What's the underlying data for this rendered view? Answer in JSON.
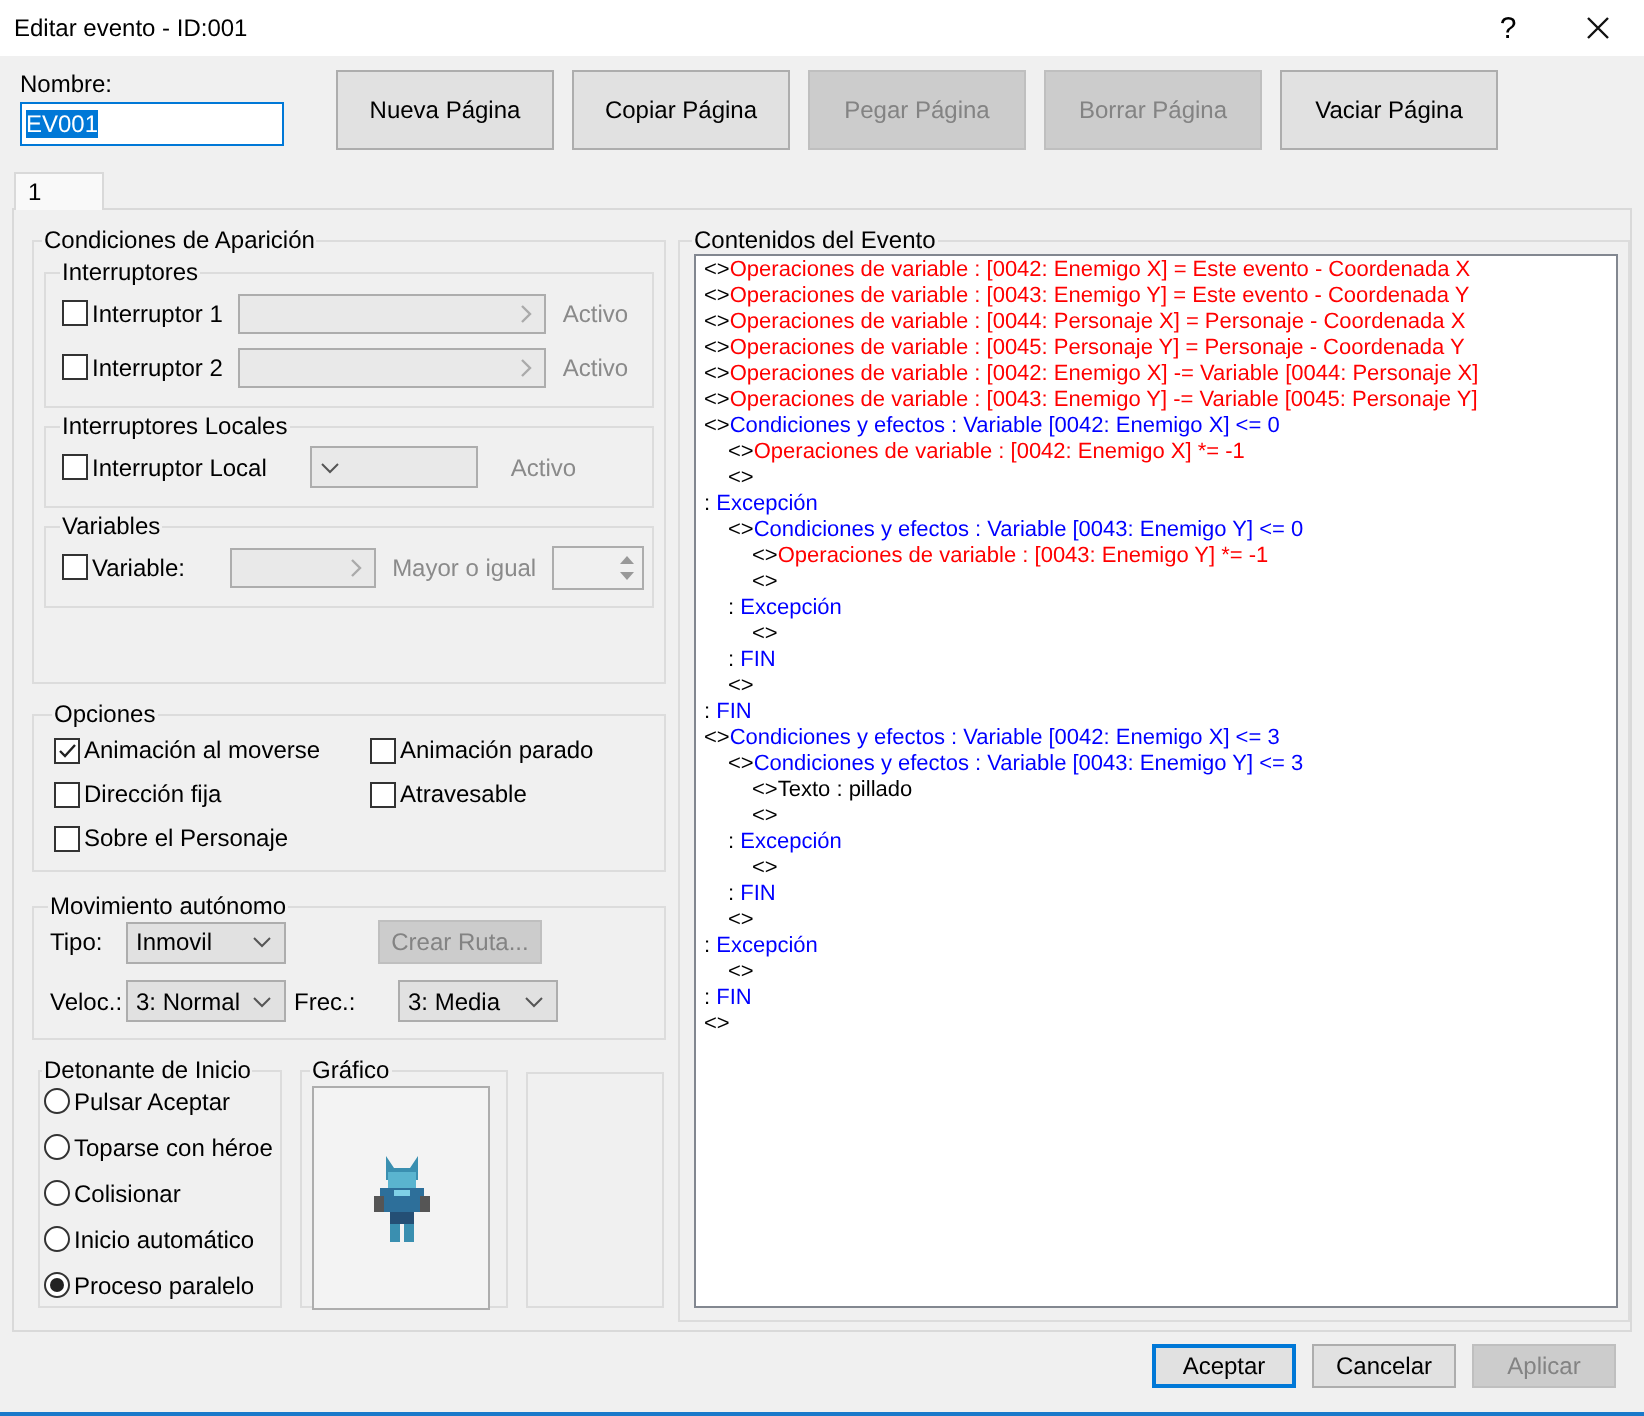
{
  "window": {
    "title": "Editar evento - ID:001",
    "help": "?"
  },
  "name_field": {
    "label": "Nombre:",
    "value": "EV001",
    "text_selected": true
  },
  "page_buttons": [
    {
      "label": "Nueva Página",
      "disabled": false
    },
    {
      "label": "Copiar Página",
      "disabled": false
    },
    {
      "label": "Pegar Página",
      "disabled": true
    },
    {
      "label": "Borrar Página",
      "disabled": true
    },
    {
      "label": "Vaciar Página",
      "disabled": false
    }
  ],
  "tabs": [
    {
      "label": "1",
      "selected": true
    }
  ],
  "conditions": {
    "title": "Condiciones de Aparición",
    "switches": {
      "title": "Interruptores",
      "items": [
        {
          "label": "Interruptor 1",
          "checked": false,
          "status": "Activo"
        },
        {
          "label": "Interruptor 2",
          "checked": false,
          "status": "Activo"
        }
      ]
    },
    "local_switches": {
      "title": "Interruptores Locales",
      "label": "Interruptor Local",
      "checked": false,
      "status": "Activo"
    },
    "variables": {
      "title": "Variables",
      "label": "Variable:",
      "checked": false,
      "comparison": "Mayor o igual"
    }
  },
  "options": {
    "title": "Opciones",
    "items": [
      {
        "label": "Animación al moverse",
        "checked": true
      },
      {
        "label": "Animación parado",
        "checked": false
      },
      {
        "label": "Dirección fija",
        "checked": false
      },
      {
        "label": "Atravesable",
        "checked": false
      },
      {
        "label": "Sobre el Personaje",
        "checked": false
      }
    ]
  },
  "movement": {
    "title": "Movimiento autónomo",
    "type_label": "Tipo:",
    "type": "Inmovil",
    "route_button": {
      "label": "Crear Ruta...",
      "disabled": true
    },
    "speed_label": "Veloc.:",
    "speed": "3: Normal",
    "frequency_label": "Frec.:",
    "frequency": "3: Media"
  },
  "trigger": {
    "title": "Detonante de Inicio",
    "options": [
      {
        "label": "Pulsar Aceptar",
        "selected": false
      },
      {
        "label": "Toparse con héroe",
        "selected": false
      },
      {
        "label": "Colisionar",
        "selected": false
      },
      {
        "label": "Inicio automático",
        "selected": false
      },
      {
        "label": "Proceso paralelo",
        "selected": true
      }
    ]
  },
  "graphic": {
    "title": "Gráfico",
    "kind": "picture"
  },
  "contents": {
    "title": "Contenidos del Evento",
    "lines": [
      {
        "prefix": "<>",
        "text": "Operaciones de variable : [0042: Enemigo X] = Este evento - Coordenada X",
        "kind": "command"
      },
      {
        "prefix": "<>",
        "text": "Operaciones de variable : [0043: Enemigo Y] = Este evento - Coordenada Y",
        "kind": "command"
      },
      {
        "prefix": "<>",
        "text": "Operaciones de variable : [0044: Personaje X] = Personaje - Coordenada X",
        "kind": "command"
      },
      {
        "prefix": "<>",
        "text": "Operaciones de variable : [0045: Personaje Y] = Personaje - Coordenada Y",
        "kind": "command"
      },
      {
        "prefix": "<>",
        "text": "Operaciones de variable : [0042: Enemigo X] -= Variable [0044: Personaje X]",
        "kind": "command"
      },
      {
        "prefix": "<>",
        "text": "Operaciones de variable : [0043: Enemigo Y] -= Variable [0045: Personaje Y]",
        "kind": "command"
      },
      {
        "prefix": "<>",
        "text": "Condiciones y efectos : Variable [0042: Enemigo X] <= 0",
        "kind": "condition",
        "children": [
          {
            "prefix": "<>",
            "text": "Operaciones de variable : [0042: Enemigo X] *= -1",
            "kind": "command"
          },
          {
            "prefix": "<>",
            "kind": "empty"
          }
        ]
      },
      {
        "prefix": ":",
        "text": "Excepción",
        "kind": "branch",
        "children": [
          {
            "prefix": "<>",
            "text": "Condiciones y efectos : Variable [0043: Enemigo Y] <= 0",
            "kind": "condition",
            "children": [
              {
                "prefix": "<>",
                "text": "Operaciones de variable : [0043: Enemigo Y] *= -1",
                "kind": "command"
              },
              {
                "prefix": "<>",
                "kind": "empty"
              }
            ]
          },
          {
            "prefix": ":",
            "text": "Excepción",
            "kind": "branch",
            "children": [
              {
                "prefix": "<>",
                "kind": "empty"
              }
            ]
          },
          {
            "prefix": ":",
            "text": "FIN",
            "kind": "branch"
          },
          {
            "prefix": "<>",
            "kind": "empty"
          }
        ]
      },
      {
        "prefix": ":",
        "text": "FIN",
        "kind": "branch"
      },
      {
        "prefix": "<>",
        "text": "Condiciones y efectos : Variable [0042: Enemigo X] <= 3",
        "kind": "condition",
        "children": [
          {
            "prefix": "<>",
            "text": "Condiciones y efectos : Variable [0043: Enemigo Y] <= 3",
            "kind": "condition",
            "children": [
              {
                "prefix": "<>",
                "text": "Texto : pillado",
                "kind": "text"
              },
              {
                "prefix": "<>",
                "kind": "empty"
              }
            ]
          },
          {
            "prefix": ":",
            "text": "Excepción",
            "kind": "branch",
            "children": [
              {
                "prefix": "<>",
                "kind": "empty"
              }
            ]
          },
          {
            "prefix": ":",
            "text": "FIN",
            "kind": "branch"
          },
          {
            "prefix": "<>",
            "kind": "empty"
          }
        ]
      },
      {
        "prefix": ":",
        "text": "Excepción",
        "kind": "branch",
        "children": [
          {
            "prefix": "<>",
            "kind": "empty"
          }
        ]
      },
      {
        "prefix": ":",
        "text": "FIN",
        "kind": "branch"
      },
      {
        "prefix": "<>",
        "kind": "empty"
      }
    ]
  },
  "footer_buttons": [
    {
      "label": "Aceptar",
      "kind": "default",
      "disabled": false
    },
    {
      "label": "Cancelar",
      "kind": "normal",
      "disabled": false
    },
    {
      "label": "Aplicar",
      "kind": "normal",
      "disabled": true
    }
  ]
}
